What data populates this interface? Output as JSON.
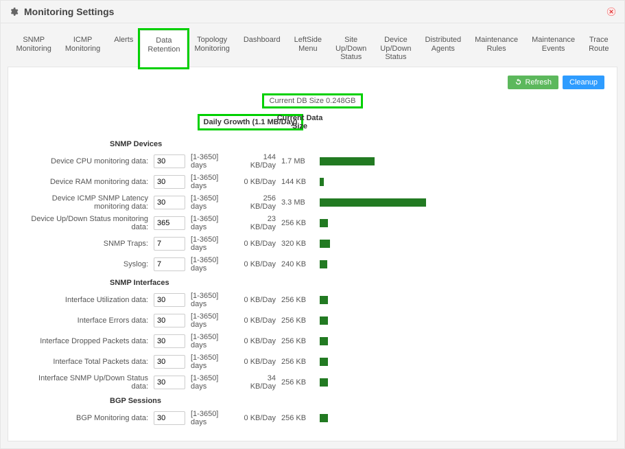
{
  "header": {
    "title": "Monitoring Settings"
  },
  "tabs": [
    "SNMP\nMonitoring",
    "ICMP\nMonitoring",
    "Alerts",
    "Data\nRetention",
    "Topology\nMonitoring",
    "Dashboard",
    "LeftSide\nMenu",
    "Site\nUp/Down\nStatus",
    "Device\nUp/Down\nStatus",
    "Distributed\nAgents",
    "Maintenance\nRules",
    "Maintenance\nEvents",
    "Trace\nRoute"
  ],
  "active_tab_index": 3,
  "buttons": {
    "refresh": "Refresh",
    "cleanup": "Cleanup"
  },
  "current_db": "Current DB Size 0.248GB",
  "col_headers": {
    "daily": "Daily Growth (1.1 MB/Day)",
    "size": "Current Data Size"
  },
  "range_hint": "[1-3650] days",
  "sections": [
    {
      "title": "SNMP Devices",
      "rows": [
        {
          "label": "Device CPU monitoring data:",
          "value": "30",
          "daily": "144 KB/Day",
          "size": "1.7 MB",
          "bar": 80
        },
        {
          "label": "Device RAM monitoring data:",
          "value": "30",
          "daily": "0 KB/Day",
          "size": "144 KB",
          "bar": 6
        },
        {
          "label": "Device ICMP SNMP Latency monitoring data:",
          "value": "30",
          "daily": "256 KB/Day",
          "size": "3.3 MB",
          "bar": 155
        },
        {
          "label": "Device Up/Down Status monitoring data:",
          "value": "365",
          "daily": "23 KB/Day",
          "size": "256 KB",
          "bar": 12
        },
        {
          "label": "SNMP Traps:",
          "value": "7",
          "daily": "0 KB/Day",
          "size": "320 KB",
          "bar": 15
        },
        {
          "label": "Syslog:",
          "value": "7",
          "daily": "0 KB/Day",
          "size": "240 KB",
          "bar": 11
        }
      ]
    },
    {
      "title": "SNMP Interfaces",
      "rows": [
        {
          "label": "Interface Utilization data:",
          "value": "30",
          "daily": "0 KB/Day",
          "size": "256 KB",
          "bar": 12
        },
        {
          "label": "Interface Errors data:",
          "value": "30",
          "daily": "0 KB/Day",
          "size": "256 KB",
          "bar": 12
        },
        {
          "label": "Interface Dropped Packets data:",
          "value": "30",
          "daily": "0 KB/Day",
          "size": "256 KB",
          "bar": 12
        },
        {
          "label": "Interface Total Packets data:",
          "value": "30",
          "daily": "0 KB/Day",
          "size": "256 KB",
          "bar": 12
        },
        {
          "label": "Interface SNMP Up/Down Status data:",
          "value": "30",
          "daily": "34 KB/Day",
          "size": "256 KB",
          "bar": 12
        }
      ]
    },
    {
      "title": "BGP Sessions",
      "rows": [
        {
          "label": "BGP Monitoring data:",
          "value": "30",
          "daily": "0 KB/Day",
          "size": "256 KB",
          "bar": 12
        }
      ]
    }
  ]
}
